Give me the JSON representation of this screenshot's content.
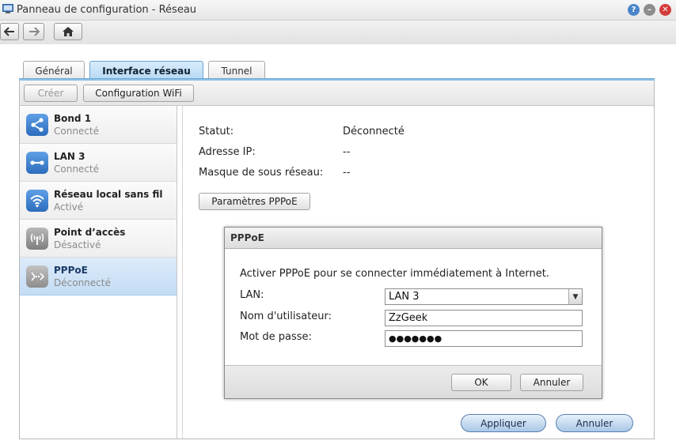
{
  "window": {
    "title": "Panneau de configuration - Réseau"
  },
  "tabs": [
    {
      "label": "Général",
      "active": false
    },
    {
      "label": "Interface réseau",
      "active": true
    },
    {
      "label": "Tunnel",
      "active": false
    }
  ],
  "subtoolbar": {
    "create_label": "Créer",
    "wifi_config_label": "Configuration WiFi"
  },
  "interfaces": [
    {
      "name": "Bond 1",
      "status": "Connecté",
      "icon": "share-icon",
      "selected": false
    },
    {
      "name": "LAN 3",
      "status": "Connecté",
      "icon": "ethernet-icon",
      "selected": false
    },
    {
      "name": "Réseau local sans fil",
      "status": "Activé",
      "icon": "wifi-icon",
      "selected": false
    },
    {
      "name": "Point d’accès",
      "status": "Désactivé",
      "icon": "access-point-icon",
      "selected": false
    },
    {
      "name": "PPPoE",
      "status": "Déconnecté",
      "icon": "pppoe-icon",
      "selected": true
    }
  ],
  "info": {
    "status_label": "Statut:",
    "status_value": "Déconnecté",
    "ip_label": "Adresse IP:",
    "ip_value": "--",
    "mask_label": "Masque de sous réseau:",
    "mask_value": "--",
    "pppoe_settings_label": "Paramètres PPPoE"
  },
  "dialog": {
    "title": "PPPoE",
    "description": "Activer PPPoE pour se connecter immédiatement à Internet.",
    "lan_label": "LAN:",
    "lan_value": "LAN 3",
    "username_label": "Nom d'utilisateur:",
    "username_value": "ZzGeek",
    "password_label": "Mot de passe:",
    "password_value": "●●●●●●●",
    "ok_label": "OK",
    "cancel_label": "Annuler"
  },
  "footer": {
    "apply_label": "Appliquer",
    "cancel_label": "Annuler"
  },
  "colors": {
    "accent": "#8ec0e6",
    "selected_row": "#c4dcf4",
    "icon_blue": "#3a7fd0",
    "icon_gray": "#8d8d8d"
  }
}
